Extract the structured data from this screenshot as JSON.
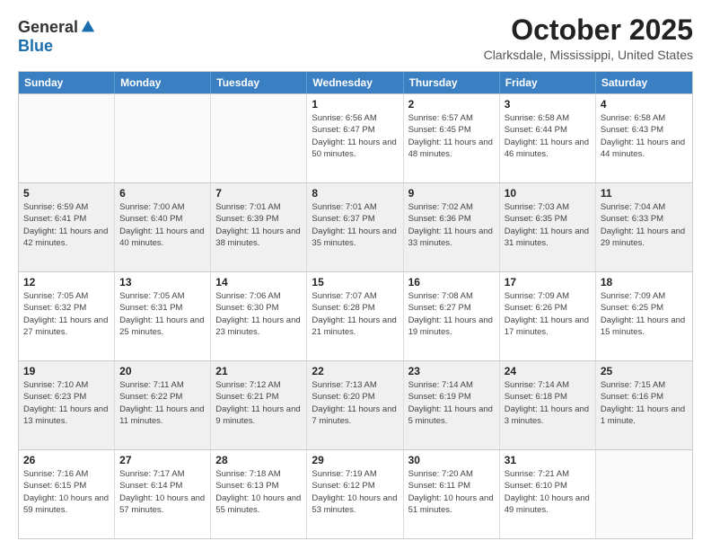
{
  "header": {
    "logo_general": "General",
    "logo_blue": "Blue",
    "month_title": "October 2025",
    "location": "Clarksdale, Mississippi, United States"
  },
  "calendar": {
    "weekdays": [
      "Sunday",
      "Monday",
      "Tuesday",
      "Wednesday",
      "Thursday",
      "Friday",
      "Saturday"
    ],
    "rows": [
      [
        {
          "day": "",
          "empty": true
        },
        {
          "day": "",
          "empty": true
        },
        {
          "day": "",
          "empty": true
        },
        {
          "day": "1",
          "sunrise": "6:56 AM",
          "sunset": "6:47 PM",
          "daylight": "11 hours and 50 minutes."
        },
        {
          "day": "2",
          "sunrise": "6:57 AM",
          "sunset": "6:45 PM",
          "daylight": "11 hours and 48 minutes."
        },
        {
          "day": "3",
          "sunrise": "6:58 AM",
          "sunset": "6:44 PM",
          "daylight": "11 hours and 46 minutes."
        },
        {
          "day": "4",
          "sunrise": "6:58 AM",
          "sunset": "6:43 PM",
          "daylight": "11 hours and 44 minutes."
        }
      ],
      [
        {
          "day": "5",
          "sunrise": "6:59 AM",
          "sunset": "6:41 PM",
          "daylight": "11 hours and 42 minutes."
        },
        {
          "day": "6",
          "sunrise": "7:00 AM",
          "sunset": "6:40 PM",
          "daylight": "11 hours and 40 minutes."
        },
        {
          "day": "7",
          "sunrise": "7:01 AM",
          "sunset": "6:39 PM",
          "daylight": "11 hours and 38 minutes."
        },
        {
          "day": "8",
          "sunrise": "7:01 AM",
          "sunset": "6:37 PM",
          "daylight": "11 hours and 35 minutes."
        },
        {
          "day": "9",
          "sunrise": "7:02 AM",
          "sunset": "6:36 PM",
          "daylight": "11 hours and 33 minutes."
        },
        {
          "day": "10",
          "sunrise": "7:03 AM",
          "sunset": "6:35 PM",
          "daylight": "11 hours and 31 minutes."
        },
        {
          "day": "11",
          "sunrise": "7:04 AM",
          "sunset": "6:33 PM",
          "daylight": "11 hours and 29 minutes."
        }
      ],
      [
        {
          "day": "12",
          "sunrise": "7:05 AM",
          "sunset": "6:32 PM",
          "daylight": "11 hours and 27 minutes."
        },
        {
          "day": "13",
          "sunrise": "7:05 AM",
          "sunset": "6:31 PM",
          "daylight": "11 hours and 25 minutes."
        },
        {
          "day": "14",
          "sunrise": "7:06 AM",
          "sunset": "6:30 PM",
          "daylight": "11 hours and 23 minutes."
        },
        {
          "day": "15",
          "sunrise": "7:07 AM",
          "sunset": "6:28 PM",
          "daylight": "11 hours and 21 minutes."
        },
        {
          "day": "16",
          "sunrise": "7:08 AM",
          "sunset": "6:27 PM",
          "daylight": "11 hours and 19 minutes."
        },
        {
          "day": "17",
          "sunrise": "7:09 AM",
          "sunset": "6:26 PM",
          "daylight": "11 hours and 17 minutes."
        },
        {
          "day": "18",
          "sunrise": "7:09 AM",
          "sunset": "6:25 PM",
          "daylight": "11 hours and 15 minutes."
        }
      ],
      [
        {
          "day": "19",
          "sunrise": "7:10 AM",
          "sunset": "6:23 PM",
          "daylight": "11 hours and 13 minutes."
        },
        {
          "day": "20",
          "sunrise": "7:11 AM",
          "sunset": "6:22 PM",
          "daylight": "11 hours and 11 minutes."
        },
        {
          "day": "21",
          "sunrise": "7:12 AM",
          "sunset": "6:21 PM",
          "daylight": "11 hours and 9 minutes."
        },
        {
          "day": "22",
          "sunrise": "7:13 AM",
          "sunset": "6:20 PM",
          "daylight": "11 hours and 7 minutes."
        },
        {
          "day": "23",
          "sunrise": "7:14 AM",
          "sunset": "6:19 PM",
          "daylight": "11 hours and 5 minutes."
        },
        {
          "day": "24",
          "sunrise": "7:14 AM",
          "sunset": "6:18 PM",
          "daylight": "11 hours and 3 minutes."
        },
        {
          "day": "25",
          "sunrise": "7:15 AM",
          "sunset": "6:16 PM",
          "daylight": "11 hours and 1 minute."
        }
      ],
      [
        {
          "day": "26",
          "sunrise": "7:16 AM",
          "sunset": "6:15 PM",
          "daylight": "10 hours and 59 minutes."
        },
        {
          "day": "27",
          "sunrise": "7:17 AM",
          "sunset": "6:14 PM",
          "daylight": "10 hours and 57 minutes."
        },
        {
          "day": "28",
          "sunrise": "7:18 AM",
          "sunset": "6:13 PM",
          "daylight": "10 hours and 55 minutes."
        },
        {
          "day": "29",
          "sunrise": "7:19 AM",
          "sunset": "6:12 PM",
          "daylight": "10 hours and 53 minutes."
        },
        {
          "day": "30",
          "sunrise": "7:20 AM",
          "sunset": "6:11 PM",
          "daylight": "10 hours and 51 minutes."
        },
        {
          "day": "31",
          "sunrise": "7:21 AM",
          "sunset": "6:10 PM",
          "daylight": "10 hours and 49 minutes."
        },
        {
          "day": "",
          "empty": true
        }
      ]
    ]
  }
}
